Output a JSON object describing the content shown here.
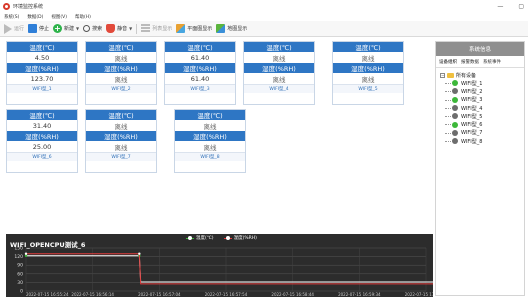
{
  "window": {
    "title": "环境监控系统",
    "minimize": "—",
    "maximize": "▢"
  },
  "menu": [
    "系统(S)",
    "数据(D)",
    "视图(V)",
    "帮助(H)"
  ],
  "toolbar": {
    "run": "运行",
    "stop": "停止",
    "new": "新建",
    "search": "搜索",
    "mute": "静音",
    "list_view": "列表显示",
    "flat_view": "平面图显示",
    "map_view": "地图显示"
  },
  "devices": [
    {
      "temp_label": "温度(℃)",
      "temp": "4.50",
      "hum_label": "湿度(%RH)",
      "hum": "123.70",
      "name": "WIFI型_1",
      "offline": false
    },
    {
      "temp_label": "温度(℃)",
      "temp": "离线",
      "hum_label": "湿度(%RH)",
      "hum": "离线",
      "name": "WIFI型_2",
      "offline": true
    },
    {
      "temp_label": "温度(℃)",
      "temp": "61.40",
      "hum_label": "湿度(%RH)",
      "hum": "61.40",
      "name": "WIFI型_3",
      "offline": false
    },
    {
      "temp_label": "温度(℃)",
      "temp": "离线",
      "hum_label": "湿度(%RH)",
      "hum": "离线",
      "name": "WIFI型_4",
      "offline": true
    },
    {
      "temp_label": "温度(℃)",
      "temp": "离线",
      "hum_label": "湿度(%RH)",
      "hum": "离线",
      "name": "WIFI型_5",
      "offline": true
    },
    {
      "temp_label": "温度(℃)",
      "temp": "31.40",
      "hum_label": "湿度(%RH)",
      "hum": "25.00",
      "name": "WIFI型_6",
      "offline": false
    },
    {
      "temp_label": "温度(℃)",
      "temp": "离线",
      "hum_label": "湿度(%RH)",
      "hum": "离线",
      "name": "WIFI型_7",
      "offline": true
    },
    {
      "temp_label": "温度(℃)",
      "temp": "离线",
      "hum_label": "湿度(%RH)",
      "hum": "离线",
      "name": "WIFI型_8",
      "offline": true
    }
  ],
  "side": {
    "header": "系统信息",
    "tabs": [
      "设备组织",
      "报警数据",
      "系统事件"
    ],
    "root": "所有设备",
    "items": [
      {
        "label": "WIFI型_1",
        "status": "online"
      },
      {
        "label": "WIFI型_2",
        "status": "offline"
      },
      {
        "label": "WIFI型_3",
        "status": "online"
      },
      {
        "label": "WIFI型_4",
        "status": "offline"
      },
      {
        "label": "WIFI型_5",
        "status": "offline"
      },
      {
        "label": "WIFI型_6",
        "status": "online"
      },
      {
        "label": "WIFI型_7",
        "status": "offline"
      },
      {
        "label": "WIFI型_8",
        "status": "offline"
      }
    ]
  },
  "colors": {
    "header_blue": "#2e76c4",
    "temp_series": "#ffffff",
    "hum_series": "#e03b3b",
    "temp_marker": "#3db83a",
    "chart_bg": "#2c2c2c"
  },
  "chart_data": {
    "type": "line",
    "title": "WIFI_OPENCPU测试_6",
    "xlabel": "",
    "ylabel": "",
    "ylim": [
      0,
      150
    ],
    "y_ticks": [
      0,
      30,
      60,
      90,
      120,
      150
    ],
    "x_tick_labels": [
      "2022-07-15 16:55:24",
      "2022-07-15 16:56:14",
      "2022-07-15 16:57:04",
      "2022-07-15 16:57:54",
      "2022-07-15 16:58:44",
      "2022-07-15 16:59:34",
      "2022-07-15 17:00:24"
    ],
    "grid": true,
    "legend": "top-center",
    "series": [
      {
        "name": "温度(℃)",
        "color": "#ffffff",
        "marker": "#3db83a",
        "x": [
          0,
          1.7,
          1.72,
          6.3
        ],
        "values": [
          123,
          123,
          31.4,
          31.4
        ]
      },
      {
        "name": "湿度(%RH)",
        "color": "#e03b3b",
        "marker": "#ffffff",
        "x": [
          0,
          1.7,
          1.72,
          6.3
        ],
        "values": [
          130,
          130,
          25,
          25
        ]
      }
    ]
  }
}
